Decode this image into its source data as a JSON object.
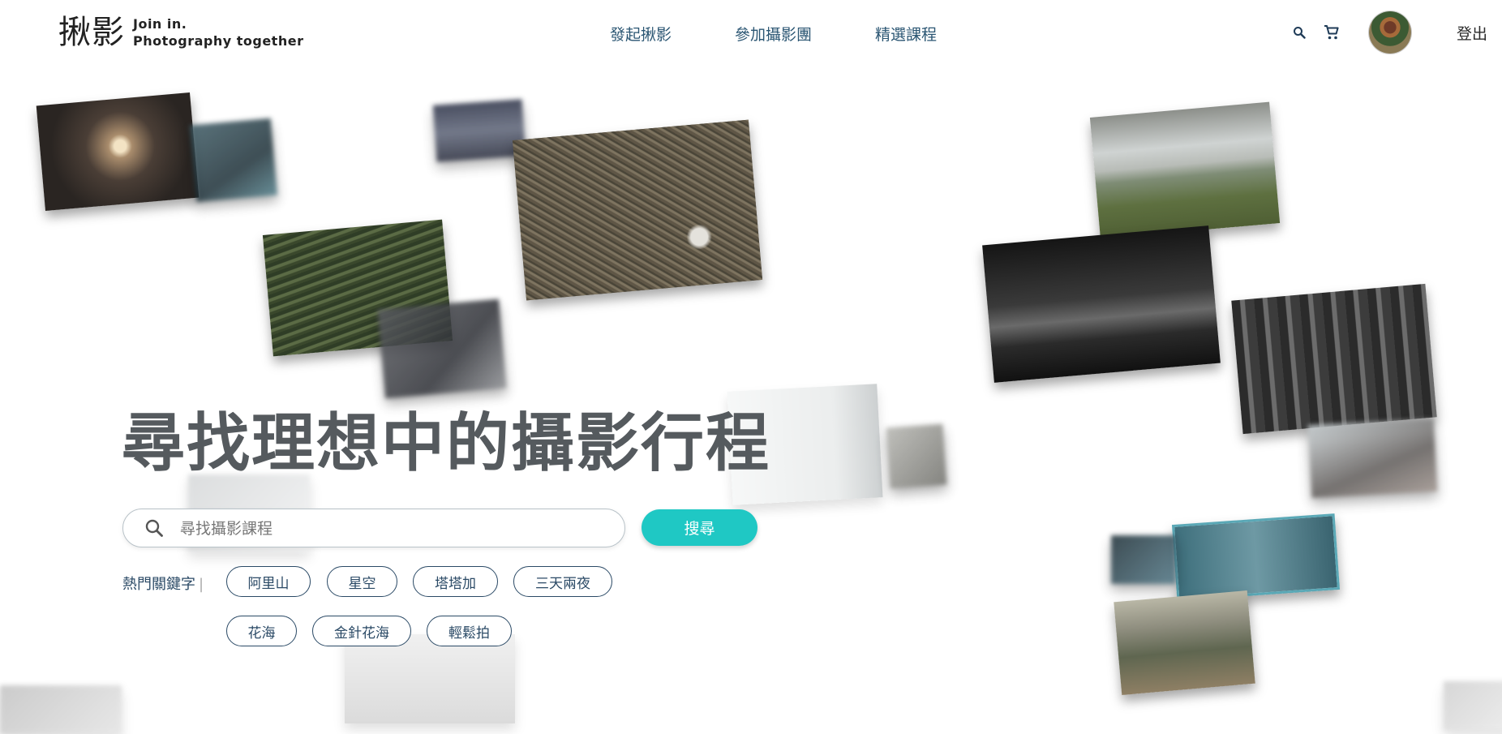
{
  "brand": {
    "mark": "揪影",
    "tagline_line1": "Join in.",
    "tagline_line2": "Photography together"
  },
  "nav": [
    {
      "label": "發起揪影"
    },
    {
      "label": "參加攝影團"
    },
    {
      "label": "精選課程"
    }
  ],
  "header": {
    "search_icon": "search-icon",
    "cart_icon": "cart-icon",
    "logout_label": "登出"
  },
  "hero": {
    "title": "尋找理想中的攝影行程"
  },
  "search": {
    "placeholder": "尋找攝影課程",
    "value": "",
    "button_label": "搜尋"
  },
  "keywords": {
    "label": "熱門關鍵字",
    "items": [
      "阿里山",
      "星空",
      "塔塔加",
      "三天兩夜",
      "花海",
      "金針花海",
      "輕鬆拍"
    ]
  },
  "colors": {
    "accent": "#1fc8c4",
    "nav": "#2b5673",
    "title": "#555a5e"
  }
}
